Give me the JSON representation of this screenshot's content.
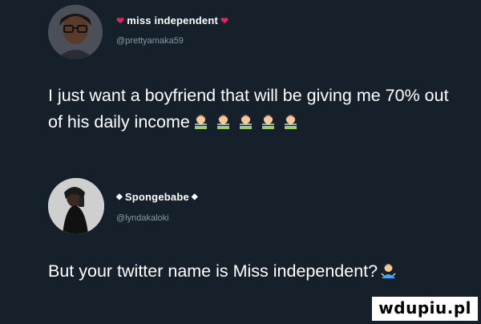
{
  "tweets": [
    {
      "display_name": "miss independent",
      "name_decoration": "heart-icon",
      "handle": "@prettyamaka59",
      "text": "I just want a boyfriend that will be giving me 70% out of his daily income",
      "trailing_emojis": [
        "woman-money-icon",
        "woman-money-icon",
        "woman-money-icon",
        "woman-money-icon",
        "woman-money-icon"
      ]
    },
    {
      "display_name": "Spongebabe",
      "name_decoration": "diamond-icon",
      "handle": "@lyndakaloki",
      "text": "But your twitter name is Miss independent?",
      "trailing_emojis": [
        "woman-shrug-icon"
      ]
    }
  ],
  "watermark": "wdupiu.pl",
  "colors": {
    "background": "#15202b",
    "heart": "#e0245e",
    "secondary_text": "#8899a6"
  }
}
